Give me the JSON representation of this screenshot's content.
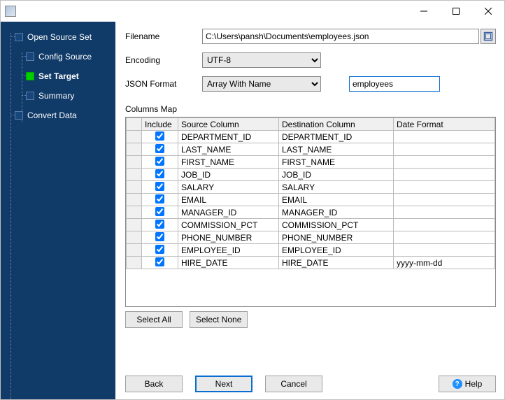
{
  "titlebar": {
    "min": "—",
    "max": "▢",
    "close": "✕"
  },
  "sidebar": {
    "items": [
      {
        "label": "Open Source Set"
      },
      {
        "label": "Config Source"
      },
      {
        "label": "Set Target"
      },
      {
        "label": "Summary"
      },
      {
        "label": "Convert Data"
      }
    ]
  },
  "form": {
    "filename_label": "Filename",
    "filename_value": "C:\\Users\\pansh\\Documents\\employees.json",
    "encoding_label": "Encoding",
    "encoding_value": "UTF-8",
    "format_label": "JSON Format",
    "format_value": "Array With Name",
    "name_value": "employees"
  },
  "columns_map": {
    "label": "Columns Map",
    "headers": {
      "include": "Include",
      "source": "Source Column",
      "destination": "Destination Column",
      "date_format": "Date Format"
    },
    "rows": [
      {
        "include": true,
        "source": "DEPARTMENT_ID",
        "destination": "DEPARTMENT_ID",
        "date_format": ""
      },
      {
        "include": true,
        "source": "LAST_NAME",
        "destination": "LAST_NAME",
        "date_format": ""
      },
      {
        "include": true,
        "source": "FIRST_NAME",
        "destination": "FIRST_NAME",
        "date_format": ""
      },
      {
        "include": true,
        "source": "JOB_ID",
        "destination": "JOB_ID",
        "date_format": ""
      },
      {
        "include": true,
        "source": "SALARY",
        "destination": "SALARY",
        "date_format": ""
      },
      {
        "include": true,
        "source": "EMAIL",
        "destination": "EMAIL",
        "date_format": ""
      },
      {
        "include": true,
        "source": "MANAGER_ID",
        "destination": "MANAGER_ID",
        "date_format": ""
      },
      {
        "include": true,
        "source": "COMMISSION_PCT",
        "destination": "COMMISSION_PCT",
        "date_format": ""
      },
      {
        "include": true,
        "source": "PHONE_NUMBER",
        "destination": "PHONE_NUMBER",
        "date_format": ""
      },
      {
        "include": true,
        "source": "EMPLOYEE_ID",
        "destination": "EMPLOYEE_ID",
        "date_format": ""
      },
      {
        "include": true,
        "source": "HIRE_DATE",
        "destination": "HIRE_DATE",
        "date_format": "yyyy-mm-dd"
      }
    ]
  },
  "buttons": {
    "select_all": "Select All",
    "select_none": "Select None",
    "back": "Back",
    "next": "Next",
    "cancel": "Cancel",
    "help": "Help"
  }
}
